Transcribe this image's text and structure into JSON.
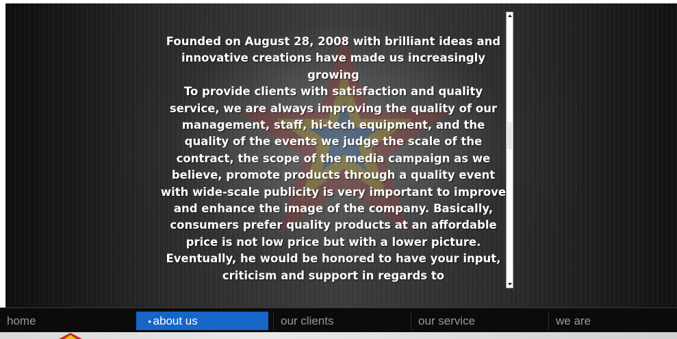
{
  "content": {
    "paragraphs": [
      "Founded on August 28, 2008 with brilliant ideas and innovative creations have made us increasingly growing",
      "To provide clients with satisfaction and quality service, we are always improving the quality of our management, staff, hi-tech equipment, and the quality of the events we judge the scale of the contract, the scope of the media campaign as we believe, promote products through a quality event with wide-scale publicity is very important to improve and enhance the image of the company. Basically, consumers prefer quality products at an affordable price is not low price but with a lower picture.",
      "Eventually, he would be honored to have your input, criticism and support in regards to"
    ]
  },
  "nav": {
    "items": [
      {
        "label": "home",
        "active": false
      },
      {
        "label": "about us",
        "active": true
      },
      {
        "label": "our clients",
        "active": false
      },
      {
        "label": "our service",
        "active": false
      },
      {
        "label": "we are",
        "active": false
      }
    ]
  },
  "colors": {
    "active_tab": "#1566c8",
    "nav_text": "#9a9a9a",
    "content_text": "#ffffff",
    "navbar_bg": "#0b0b0b"
  },
  "icons": {
    "active_marker": "triangle-right-icon",
    "watermark": "star-logo-watermark",
    "corner": "star-logo-icon"
  }
}
